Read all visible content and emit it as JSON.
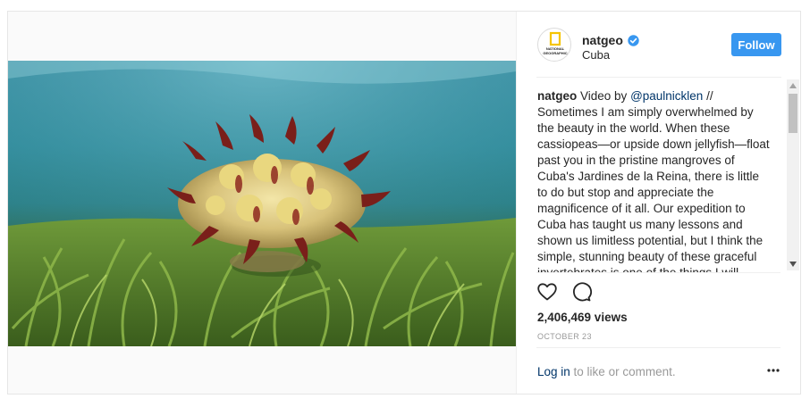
{
  "post": {
    "header": {
      "username": "natgeo",
      "location": "Cuba",
      "follow_label": "Follow",
      "avatar_text_line1": "NATIONAL",
      "avatar_text_line2": "GEOGRAPHIC"
    },
    "caption": {
      "author": "natgeo",
      "lead": " Video by ",
      "mention": "@paulnicklen",
      "body": " // Sometimes I am simply overwhelmed by the beauty in the world. When these cassiopeas—or upside down jellyfish—float past you in the pristine mangroves of Cuba's Jardines de la Reina, there is little to do but stop and appreciate the magnificence of it all. Our expedition to Cuba has taught us many lessons and shown us limitless potential, but I think the simple, stunning beauty of these graceful invertebrates is one of the things I will"
    },
    "stats": {
      "views": "2,406,469 views",
      "date": "OCTOBER 23"
    },
    "comment": {
      "login_label": "Log in",
      "prompt": " to like or comment."
    },
    "icons": {
      "like": "heart-icon",
      "comment": "comment-icon",
      "verified": "verified-badge-icon",
      "more": "more-options-icon"
    },
    "colors": {
      "follow_button": "#3897f0",
      "verified_badge": "#3897f0",
      "link": "#003569",
      "muted_text": "#999999"
    }
  }
}
